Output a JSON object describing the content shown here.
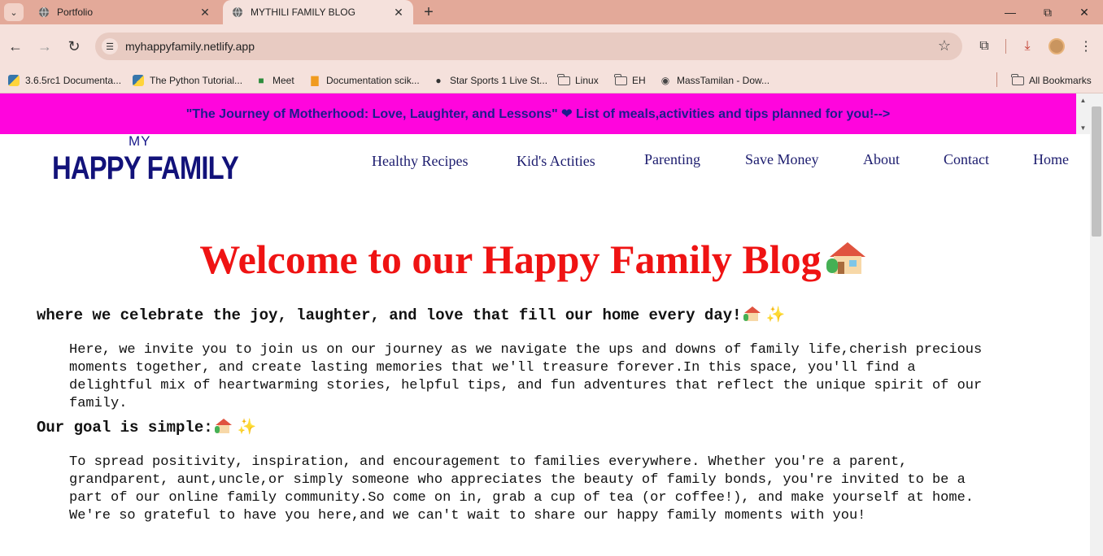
{
  "browser": {
    "tabs": [
      {
        "title": "Portfolio",
        "active": false
      },
      {
        "title": "MYTHILI FAMILY BLOG",
        "active": true
      }
    ],
    "new_tab_icon": "plus-icon",
    "url": "myhappyfamily.netlify.app",
    "bookmarks": [
      {
        "label": "3.6.5rc1 Documenta...",
        "icon": "python-icon"
      },
      {
        "label": "The Python Tutorial...",
        "icon": "python-icon"
      },
      {
        "label": "Meet",
        "icon": "meet-icon"
      },
      {
        "label": "Documentation scik...",
        "icon": "chart-icon"
      },
      {
        "label": "Star Sports 1 Live St...",
        "icon": "globe-icon"
      },
      {
        "label": "Linux",
        "icon": "folder-icon"
      },
      {
        "label": "EH",
        "icon": "folder-icon"
      },
      {
        "label": "MassTamilan - Dow...",
        "icon": "site-icon"
      }
    ],
    "all_bookmarks": "All Bookmarks"
  },
  "page": {
    "banner": "\"The Journey of Motherhood: Love, Laughter, and Lessons\" ❤ List of meals,activities and tips planned for you!-->",
    "logo": {
      "small": "MY",
      "big": "HAPPY FAMILY"
    },
    "nav": [
      "Healthy Recipes",
      "Kid's Actities",
      "Parenting",
      "Save Money",
      "About",
      "Contact",
      "Home"
    ],
    "hero_title": "Welcome to our Happy Family Blog",
    "subheading1": "where we celebrate the joy, laughter, and love that fill our home every day!",
    "paragraph1": "Here, we invite you to join us on our journey as we navigate the ups and downs of family life,cherish precious moments together, and create lasting memories that we'll treasure forever.In this space, you'll find a delightful mix of heartwarming stories, helpful tips, and fun adventures that reflect the unique spirit of our family.",
    "subheading2": "Our goal is simple:",
    "paragraph2": "To spread positivity, inspiration, and encouragement to families everywhere. Whether you're a parent, grandparent, aunt,uncle,or simply someone who appreciates the beauty of family bonds, you're invited to be a part of our online family community.So come on in, grab a cup of tea (or coffee!), and make yourself at home. We're so grateful to have you here,and we can't wait to share our happy family moments with you!",
    "sparkle": "✨"
  },
  "colors": {
    "banner_bg": "#ff05dd",
    "hero_title": "#ef1313",
    "nav_text": "#1c1c6e",
    "logo": "#12127a"
  }
}
